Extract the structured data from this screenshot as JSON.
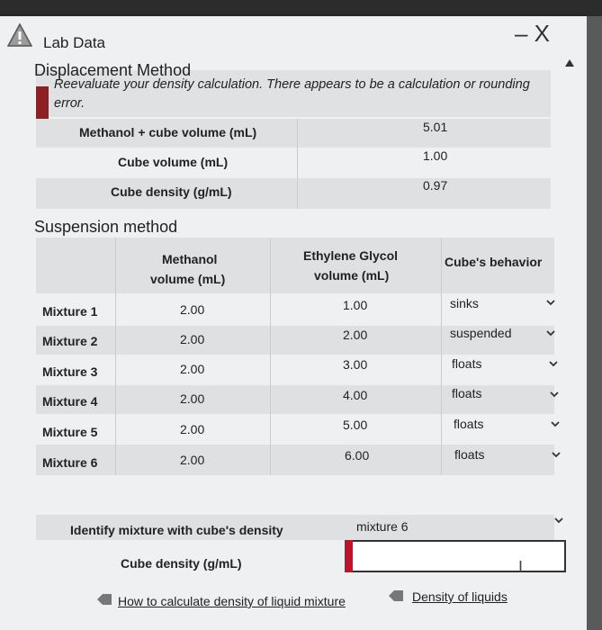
{
  "window": {
    "title": "Lab Data",
    "controls": "– X"
  },
  "displacement": {
    "heading": "Displacement Method",
    "warning": "Reevaluate your density calculation. There appears to be a calculation or rounding error.",
    "rows": [
      {
        "label": "Methanol + cube volume (mL)",
        "value": "5.01"
      },
      {
        "label": "Cube volume (mL)",
        "value": "1.00"
      },
      {
        "label": "Cube density (g/mL)",
        "value": "0.97"
      }
    ]
  },
  "suspension": {
    "heading": "Suspension method",
    "headers": {
      "methanol_l1": "Methanol",
      "methanol_l2": "volume (mL)",
      "glycol_l1": "Ethylene Glycol",
      "glycol_l2": "volume (mL)",
      "behavior": "Cube's behavior"
    },
    "rows": [
      {
        "name": "Mixture 1",
        "methanol": "2.00",
        "glycol": "1.00",
        "behavior": "sinks"
      },
      {
        "name": "Mixture 2",
        "methanol": "2.00",
        "glycol": "2.00",
        "behavior": "suspended"
      },
      {
        "name": "Mixture 3",
        "methanol": "2.00",
        "glycol": "3.00",
        "behavior": "floats"
      },
      {
        "name": "Mixture 4",
        "methanol": "2.00",
        "glycol": "4.00",
        "behavior": "floats"
      },
      {
        "name": "Mixture 5",
        "methanol": "2.00",
        "glycol": "5.00",
        "behavior": "floats"
      },
      {
        "name": "Mixture 6",
        "methanol": "2.00",
        "glycol": "6.00",
        "behavior": "floats"
      }
    ]
  },
  "identify": {
    "label": "Identify mixture with cube's density",
    "selected": "mixture 6",
    "density_label": "Cube density (g/mL)",
    "density_value": ""
  },
  "links": {
    "calc": "How to calculate density of liquid mixture",
    "density": "Density of liquids"
  },
  "colors": {
    "warning_bar": "#8d1f27",
    "input_error": "#c2122a"
  }
}
